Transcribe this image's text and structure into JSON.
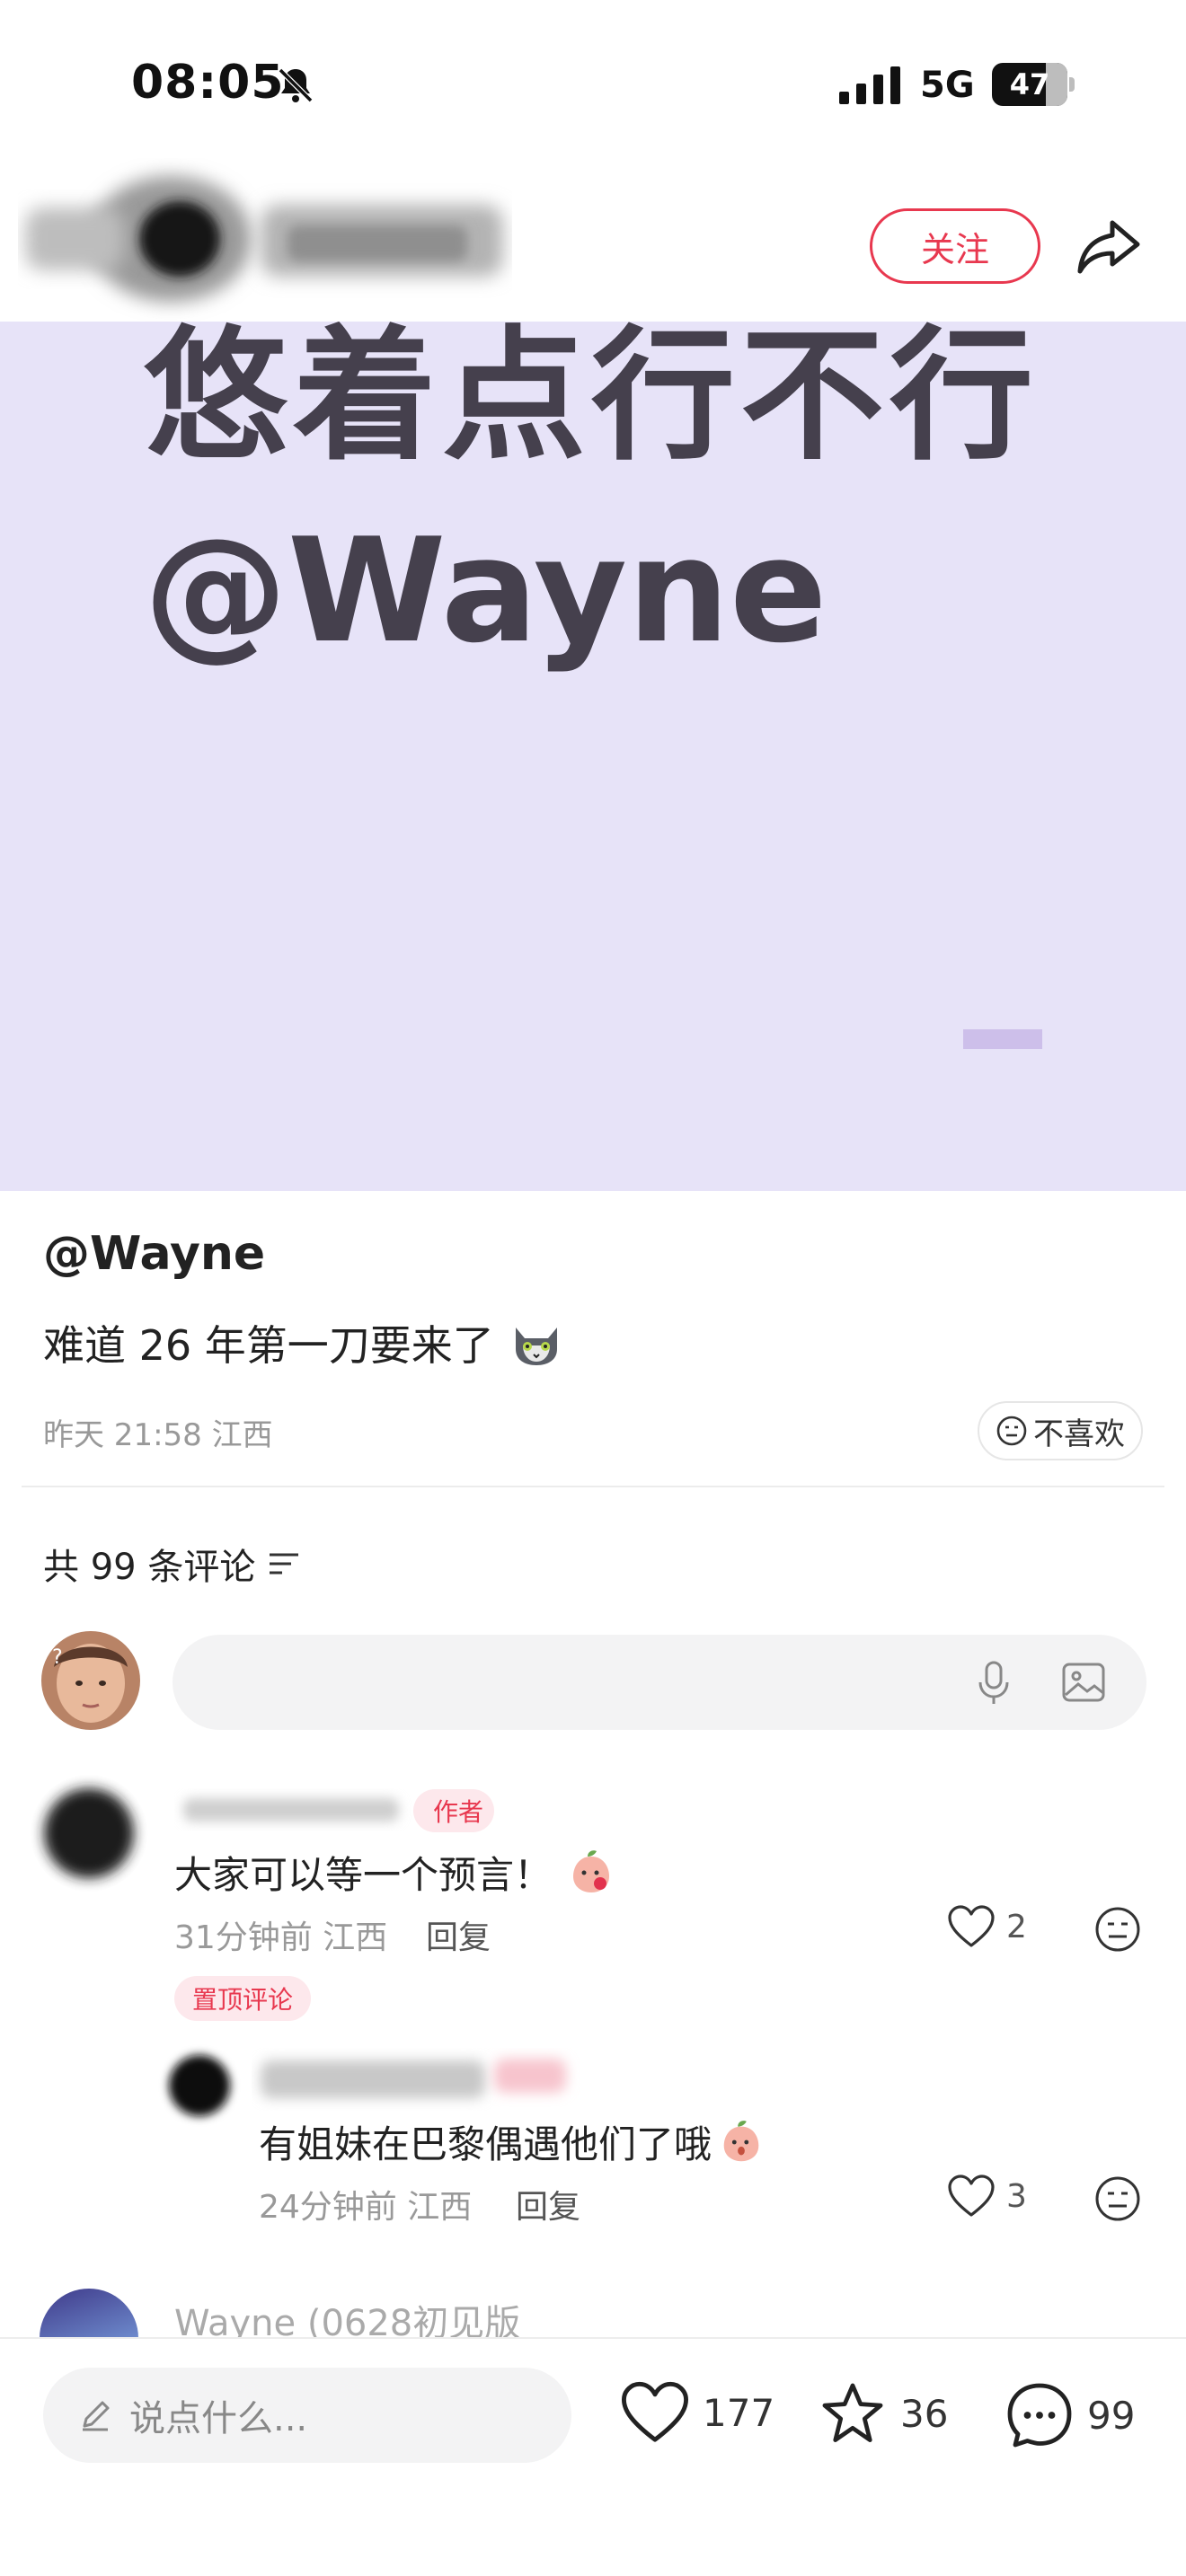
{
  "status_bar": {
    "time": "08:05",
    "network": "5G",
    "battery_level": "47",
    "battery_fraction": 0.47,
    "icons": [
      "bell-slash-icon",
      "signal-icon",
      "battery-icon"
    ]
  },
  "header": {
    "follow_label": "关注",
    "share_icon": "share-arrow-icon"
  },
  "cover": {
    "line1": "悠着点行不行",
    "line2": "@Wayne",
    "background": "#e7e3f8",
    "text_color": "#45404d"
  },
  "note": {
    "title": "@Wayne",
    "description": "难道 26 年第一刀要来了",
    "description_emoji": "cat-face-emoji",
    "meta": "昨天 21:58 江西",
    "dislike_label": "不喜欢"
  },
  "comments": {
    "count_label": "共 99 条评论",
    "items": [
      {
        "author_tag": "作者",
        "text": "大家可以等一个预言！",
        "emoji": "peach-emoji",
        "meta": "31分钟前 江西",
        "reply_label": "回复",
        "likes": "2",
        "pinned_label": "置顶评论"
      },
      {
        "text": "有姐妹在巴黎偶遇他们了哦",
        "emoji": "peach-emoji",
        "meta": "24分钟前 江西",
        "reply_label": "回复",
        "likes": "3"
      },
      {
        "name": "Wayne (0628初见版"
      }
    ]
  },
  "bottom_bar": {
    "input_placeholder": "说点什么...",
    "likes": "177",
    "collects": "36",
    "comments": "99"
  },
  "colors": {
    "accent": "#e8384f",
    "tag_bg": "#fde8ec",
    "muted_text": "#999999"
  }
}
